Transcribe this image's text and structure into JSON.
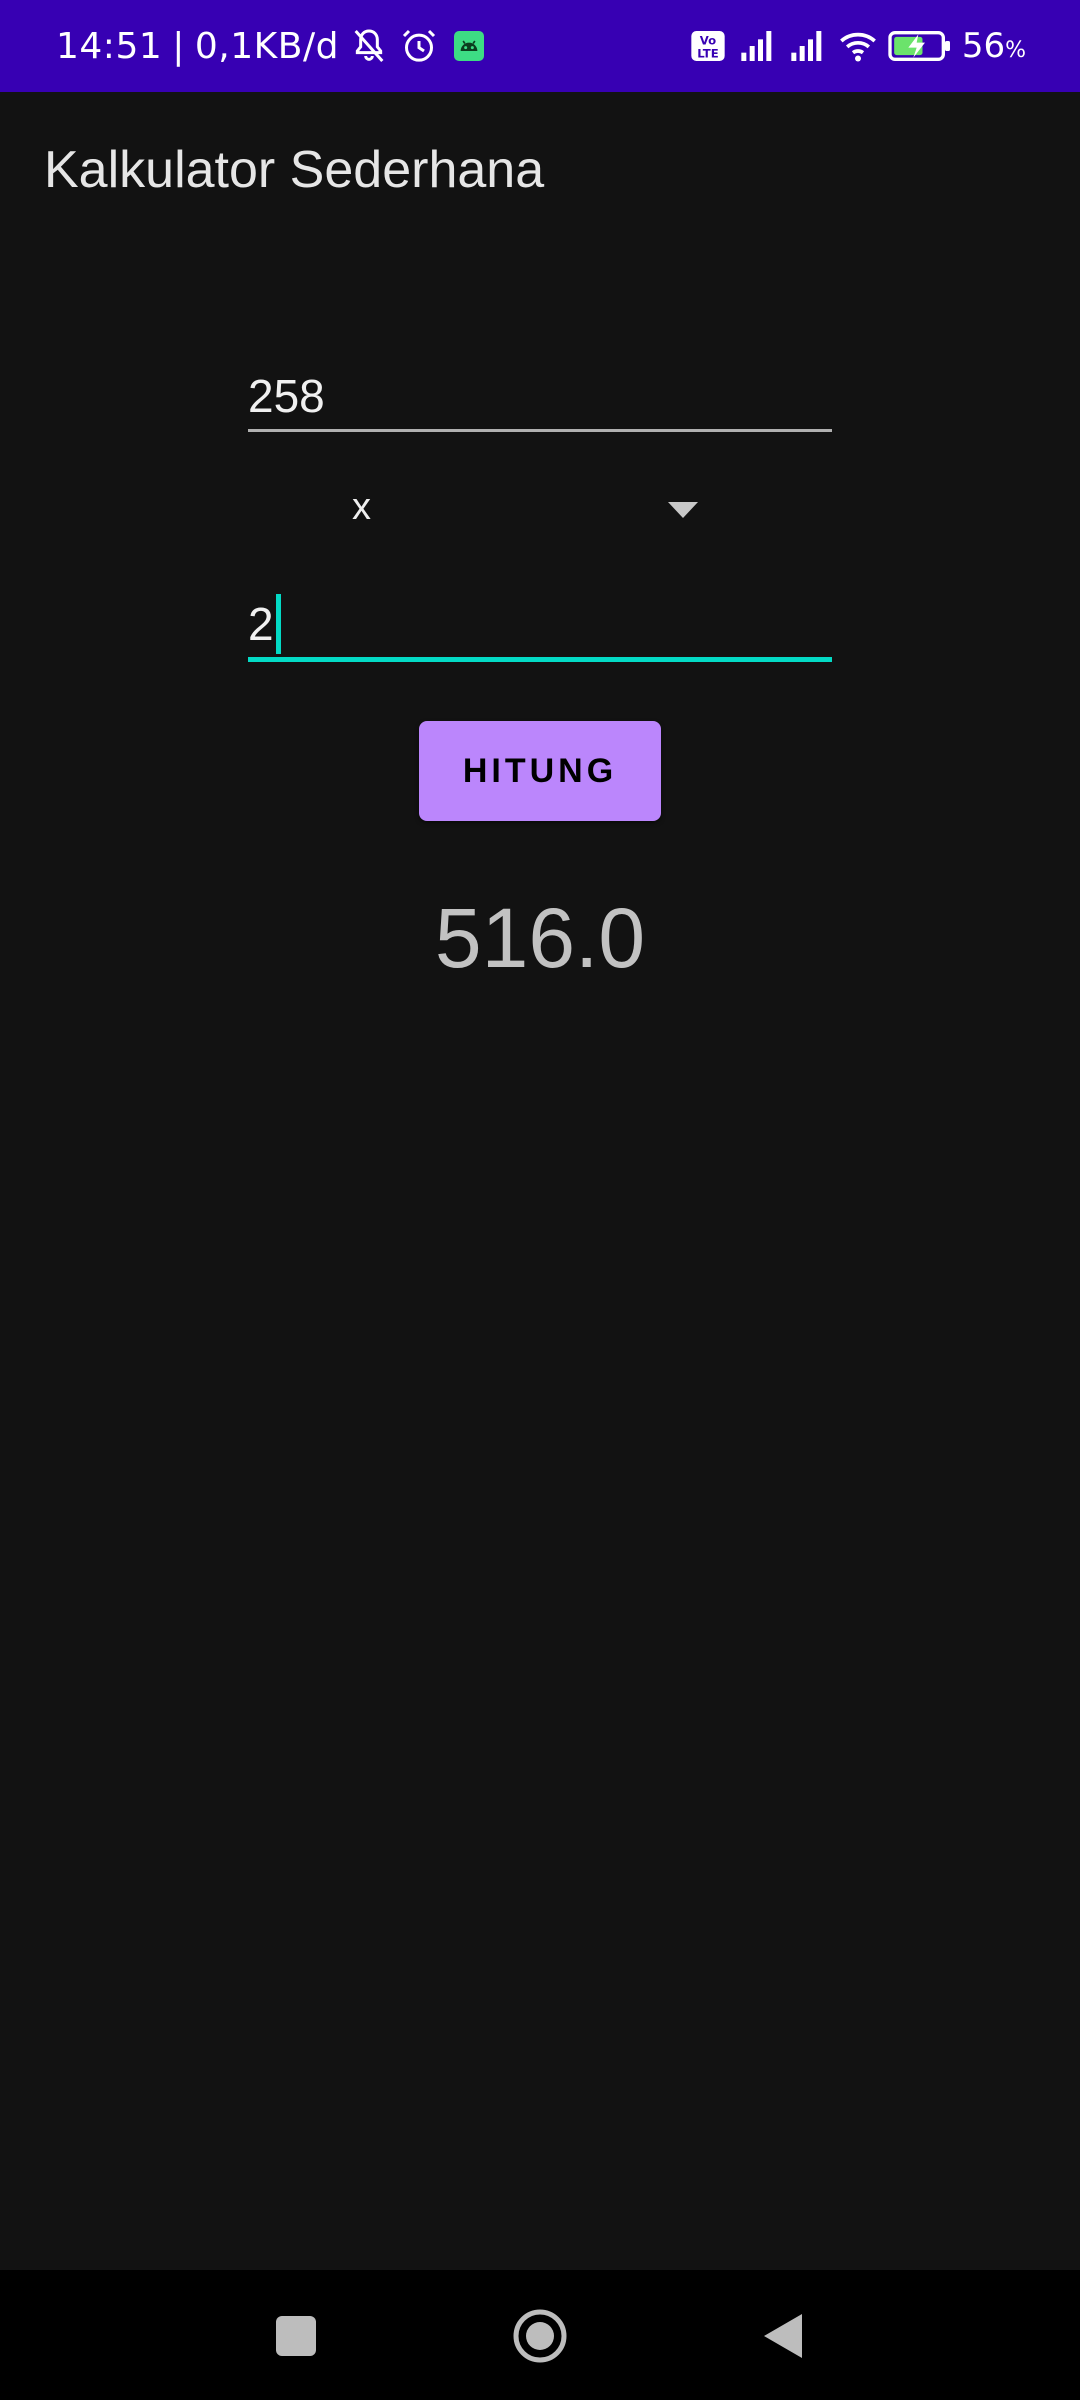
{
  "status_bar": {
    "time": "14:51",
    "separator": "|",
    "network_speed": "0,1KB/d",
    "icons_left": [
      "bell-off-icon",
      "alarm-icon",
      "android-app-icon"
    ],
    "icons_right": [
      "volte-icon",
      "signal-icon",
      "signal-icon",
      "wifi-icon",
      "battery-charging-icon"
    ],
    "battery_percent": "56",
    "battery_unit": "%"
  },
  "app": {
    "title": "Kalkulator Sederhana"
  },
  "form": {
    "first_number": "258",
    "operator": {
      "selected": "x"
    },
    "second_number": "2",
    "calculate_label": "HITUNG",
    "result": "516.0"
  },
  "nav_bar": {
    "icons": [
      "recents-icon",
      "home-icon",
      "back-icon"
    ]
  },
  "colors": {
    "status_bar": "#3700b3",
    "background": "#121212",
    "accent": "#03dac5",
    "button": "#bb86fc",
    "nav_bar": "#000000"
  }
}
